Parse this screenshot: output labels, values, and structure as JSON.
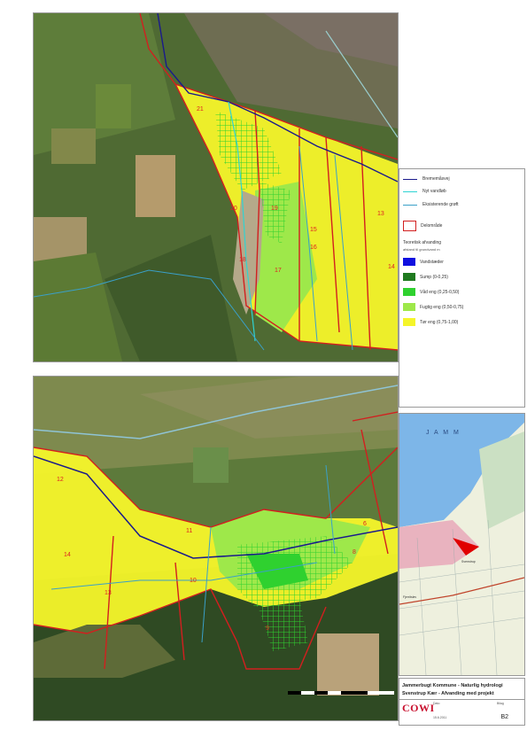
{
  "legend": {
    "items_lines": [
      {
        "label": "Brememåsvej",
        "color": "#1a1a8c"
      },
      {
        "label": "Nyt vandløb",
        "color": "#2fd3d3"
      },
      {
        "label": "Eksisterende grøft",
        "color": "#3aa0c8"
      }
    ],
    "delomraade_label": "Delområde",
    "heading": "Teoretisk afvanding",
    "subheading": "afstand til grundvand m",
    "classes": [
      {
        "label": "Vandstæder",
        "color": "#1010e0"
      },
      {
        "label": "Sump (0-0,25)",
        "color": "#1f7a1f"
      },
      {
        "label": "Våd eng (0,25-0,50)",
        "color": "#2fd12f"
      },
      {
        "label": "Fugtig eng (0,50-0,75)",
        "color": "#9ee84a"
      },
      {
        "label": "Tør eng (0,75-1,00)",
        "color": "#f5f52a"
      }
    ]
  },
  "overview": {
    "sea_label": "J A M M",
    "place_labels": [
      "Fjerritslev",
      "Svenstrup"
    ]
  },
  "title_block": {
    "line1": "Jammerbugt Kommune - Naturlig hydrologi",
    "line2": "Svenstrup Kær - Afvanding med projekt",
    "logo": "COWI",
    "date_label": "Dato",
    "date_value": "15.6.2011",
    "drawing_label": "Bilag",
    "drawing_no": "B2"
  },
  "map_top": {
    "zone_labels": [
      "21",
      "20",
      "19",
      "18",
      "17",
      "16",
      "15",
      "14",
      "13"
    ]
  },
  "map_bottom": {
    "zone_labels": [
      "14",
      "13",
      "12",
      "11",
      "10",
      "9",
      "8",
      "6"
    ]
  },
  "colors": {
    "tor_eng": "#f5f52a",
    "fugtig_eng": "#9ee84a",
    "vad_eng": "#2fd12f",
    "sump": "#1f7a1f",
    "delomraade": "#d21f1f",
    "vandlob": "#1a1a8c",
    "groft": "#3aa0c8"
  }
}
